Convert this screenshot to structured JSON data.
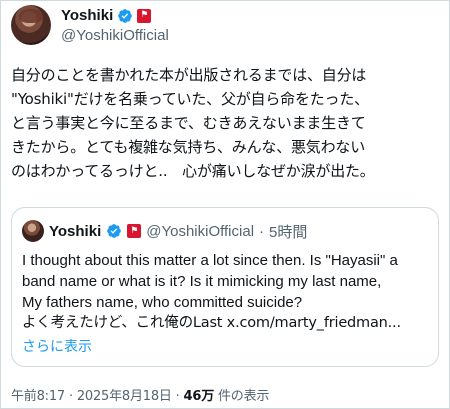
{
  "tweet": {
    "author_name": "Yoshiki",
    "author_handle": "@YoshikiOfficial",
    "lines": [
      "自分のことを書かれた本が出版されるまでは、自分は",
      "\"Yoshiki\"だけを名乗っていた、父が自ら命をたった、",
      "と言う事実と今に至るまで、むきあえないまま生きて",
      "きたから。とても複雑な気持ち、みんな、悪気わない",
      "のはわかってるっけと..　心が痛いしなぜか涙が出た。"
    ]
  },
  "quote": {
    "author_name": "Yoshiki",
    "author_handle": "@YoshikiOfficial",
    "separator": "·",
    "time": "5時間",
    "lines": [
      "I thought about this matter a lot since then. Is \"Hayasii\" a",
      "band name or what is it? Is it mimicking my last name,",
      "My fathers name, who committed suicide?",
      "よく考えたけど、これ俺のLast x.com/marty_friedman..."
    ],
    "show_more": "さらに表示"
  },
  "meta": {
    "time": "午前8:17",
    "separator": "·",
    "date": "2025年8月18日",
    "views": "46万",
    "views_label": "件の表示"
  },
  "colors": {
    "accent": "#1d9bf0",
    "secondary_text": "#536471",
    "flag_red": "#d7172f"
  },
  "icons": [
    "verified-badge-icon",
    "red-flag-badge-icon"
  ]
}
